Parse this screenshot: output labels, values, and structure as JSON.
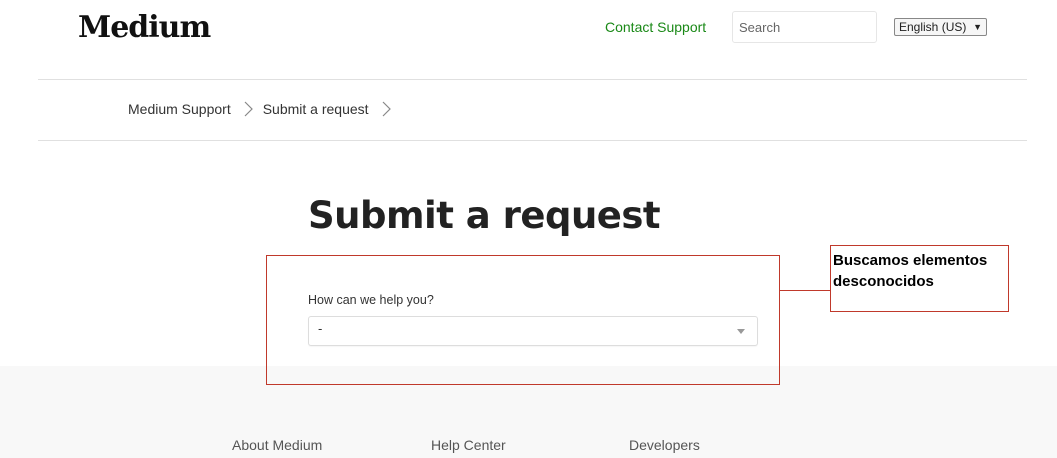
{
  "header": {
    "logo": "Medium",
    "contact_link": "Contact Support",
    "search_placeholder": "Search",
    "language": "English (US)"
  },
  "breadcrumb": [
    "Medium Support",
    "Submit a request"
  ],
  "page_title": "Submit a request",
  "form": {
    "label": "How can we help you?",
    "selected_value": "-"
  },
  "annotation": {
    "note_line1": "Buscamos elementos",
    "note_line2": "desconocidos",
    "color": "#c0392b"
  },
  "footer": {
    "links": [
      "About Medium",
      "Help Center",
      "Developers"
    ]
  },
  "colors": {
    "accent": "#1a8917",
    "footer_bg": "#f8f8f8"
  }
}
